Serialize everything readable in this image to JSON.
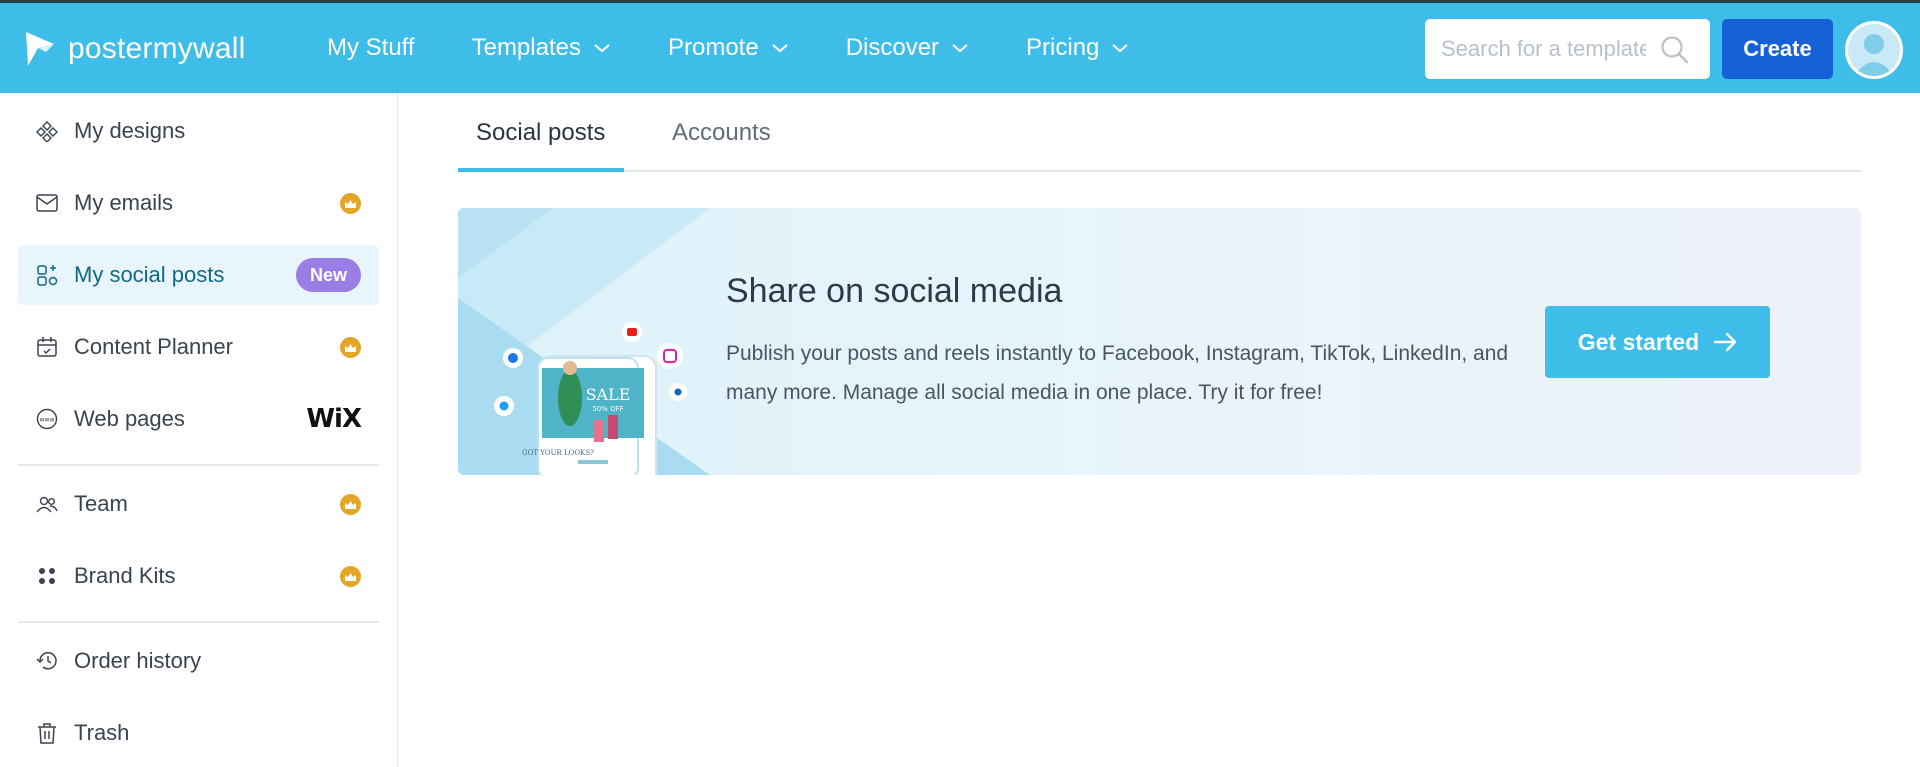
{
  "brand": {
    "logo_text": "postermywall",
    "primary": "#3fbde9",
    "create_bg": "#1660d8"
  },
  "nav": {
    "items": [
      {
        "label": "My Stuff",
        "has_chevron": false
      },
      {
        "label": "Templates",
        "has_chevron": true
      },
      {
        "label": "Promote",
        "has_chevron": true
      },
      {
        "label": "Discover",
        "has_chevron": true
      },
      {
        "label": "Pricing",
        "has_chevron": true
      }
    ],
    "search_placeholder": "Search for a template",
    "create_label": "Create"
  },
  "sidebar": {
    "items": [
      {
        "label": "My designs",
        "icon": "designs-icon"
      },
      {
        "label": "My emails",
        "icon": "mail-icon",
        "premium": true
      },
      {
        "label": "My social posts",
        "icon": "social-posts-icon",
        "badge": "New",
        "active": true
      },
      {
        "label": "Content Planner",
        "icon": "calendar-icon",
        "premium": true
      },
      {
        "label": "Web pages",
        "icon": "web-icon",
        "partner": "WiX"
      },
      {
        "label": "Team",
        "icon": "team-icon",
        "premium": true
      },
      {
        "label": "Brand Kits",
        "icon": "brand-kit-icon",
        "premium": true
      },
      {
        "label": "Order history",
        "icon": "history-icon"
      },
      {
        "label": "Trash",
        "icon": "trash-icon"
      }
    ]
  },
  "tabs": [
    {
      "label": "Social posts",
      "active": true
    },
    {
      "label": "Accounts",
      "active": false
    }
  ],
  "banner": {
    "title": "Share on social media",
    "description": "Publish your posts and reels instantly to Facebook, Instagram, TikTok, LinkedIn, and many more. Manage all social media in one place. Try it for free!",
    "cta": "Get started",
    "poster_text": {
      "sale": "SALE",
      "off": "50% OFF",
      "headline": "GOT YOUR LOOKS?"
    }
  }
}
